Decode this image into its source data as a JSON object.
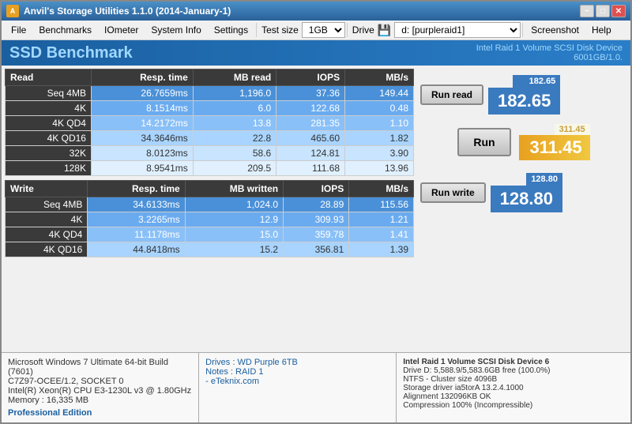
{
  "window": {
    "title": "Anvil's Storage Utilities 1.1.0 (2014-January-1)",
    "controls": {
      "minimize": "−",
      "maximize": "□",
      "close": "✕"
    }
  },
  "menu": {
    "items": [
      "File",
      "Benchmarks",
      "IOmeter",
      "System Info",
      "Settings"
    ],
    "test_size_label": "Test size",
    "test_size_value": "1GB",
    "drive_label": "Drive",
    "drive_value": "d: [purpleraid1]",
    "screenshot_label": "Screenshot",
    "help_label": "Help"
  },
  "header": {
    "title": "SSD Benchmark",
    "device_line1": "Intel Raid 1 Volume SCSI Disk Device",
    "device_line2": "6001GB/1.0."
  },
  "read_table": {
    "headers": [
      "Read",
      "Resp. time",
      "MB read",
      "IOPS",
      "MB/s"
    ],
    "rows": [
      {
        "label": "Seq 4MB",
        "resp": "26.7659ms",
        "mb": "1,196.0",
        "iops": "37.36",
        "mbs": "149.44"
      },
      {
        "label": "4K",
        "resp": "8.1514ms",
        "mb": "6.0",
        "iops": "122.68",
        "mbs": "0.48"
      },
      {
        "label": "4K QD4",
        "resp": "14.2172ms",
        "mb": "13.8",
        "iops": "281.35",
        "mbs": "1.10"
      },
      {
        "label": "4K QD16",
        "resp": "34.3646ms",
        "mb": "22.8",
        "iops": "465.60",
        "mbs": "1.82"
      },
      {
        "label": "32K",
        "resp": "8.0123ms",
        "mb": "58.6",
        "iops": "124.81",
        "mbs": "3.90"
      },
      {
        "label": "128K",
        "resp": "8.9541ms",
        "mb": "209.5",
        "iops": "111.68",
        "mbs": "13.96"
      }
    ]
  },
  "write_table": {
    "headers": [
      "Write",
      "Resp. time",
      "MB written",
      "IOPS",
      "MB/s"
    ],
    "rows": [
      {
        "label": "Seq 4MB",
        "resp": "34.6133ms",
        "mb": "1,024.0",
        "iops": "28.89",
        "mbs": "115.56"
      },
      {
        "label": "4K",
        "resp": "3.2265ms",
        "mb": "12.9",
        "iops": "309.93",
        "mbs": "1.21"
      },
      {
        "label": "4K QD4",
        "resp": "11.1178ms",
        "mb": "15.0",
        "iops": "359.78",
        "mbs": "1.41"
      },
      {
        "label": "4K QD16",
        "resp": "44.8418ms",
        "mb": "15.2",
        "iops": "356.81",
        "mbs": "1.39"
      }
    ]
  },
  "side_panel": {
    "run_read_label": "Run read",
    "read_score_small": "182.65",
    "read_score_large": "182.65",
    "run_label": "Run",
    "total_score_small": "311.45",
    "total_score_large": "311.45",
    "run_write_label": "Run write",
    "write_score_small": "128.80",
    "write_score_large": "128.80"
  },
  "footer": {
    "sys_info": [
      "Microsoft Windows 7 Ultimate  64-bit Build (7601)",
      "C7Z97-OCEE/1.2, SOCKET 0",
      "Intel(R) Xeon(R) CPU E3-1230L v3 @ 1.80GHz",
      "Memory : 16,335 MB"
    ],
    "pro_edition": "Professional Edition",
    "drives_label": "Drives : WD Purple 6TB",
    "notes_label": "Notes : RAID 1",
    "site_label": "       - eTeknix.com",
    "device_detail_title": "Intel Raid 1 Volume SCSI Disk Device 6",
    "device_detail_lines": [
      "Drive D: 5,588.9/5,583.6GB free (100.0%)",
      "NTFS - Cluster size 4096B",
      "Storage driver ia5torA 13.2.4.1000",
      "",
      "Alignment 132096KB OK",
      "Compression 100% (Incompressible)"
    ]
  }
}
